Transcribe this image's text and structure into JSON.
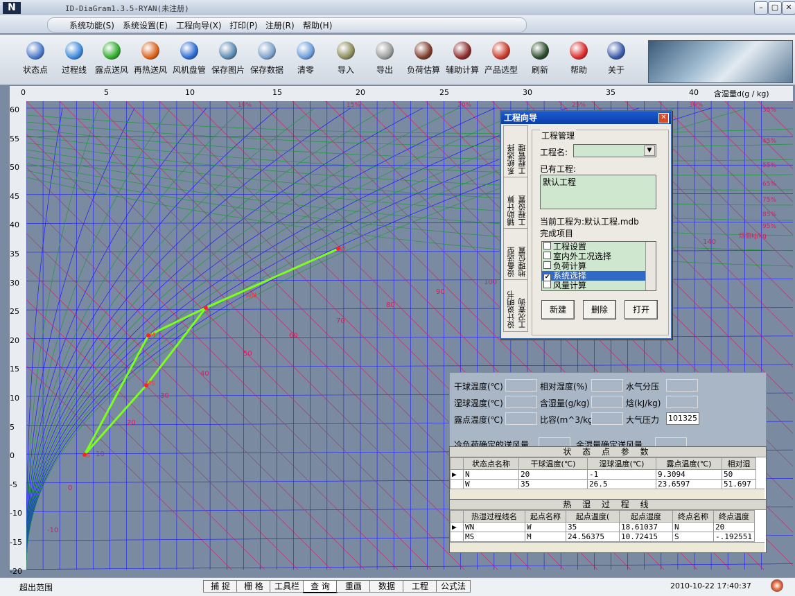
{
  "window": {
    "title": "ID-DiaGram1.3.5-RYAN(未注册)",
    "app_icon": "N"
  },
  "menu": [
    "系统功能(S)",
    "系统设置(E)",
    "工程向导(X)",
    "打印(P)",
    "注册(R)",
    "帮助(H)"
  ],
  "toolbar": [
    {
      "label": "状态点",
      "icon": "state-point-icon",
      "color": "#4a78c8"
    },
    {
      "label": "过程线",
      "icon": "process-line-icon",
      "color": "#3b88d8"
    },
    {
      "label": "露点送风",
      "icon": "green-ball-icon",
      "color": "#2faa2a"
    },
    {
      "label": "再热送风",
      "icon": "orange-ball-icon",
      "color": "#d8621c"
    },
    {
      "label": "风机盘管",
      "icon": "blue-ball-icon",
      "color": "#2a6ad0"
    },
    {
      "label": "保存图片",
      "icon": "save-image-icon",
      "color": "#5a88b0"
    },
    {
      "label": "保存数据",
      "icon": "save-data-icon",
      "color": "#7aa0c8"
    },
    {
      "label": "清零",
      "icon": "clear-icon",
      "color": "#6a9ad8"
    },
    {
      "label": "导入",
      "icon": "import-icon",
      "color": "#8a8a5a"
    },
    {
      "label": "导出",
      "icon": "export-icon",
      "color": "#999999"
    },
    {
      "label": "负荷估算",
      "icon": "load-estimate-icon",
      "color": "#7a3a2a"
    },
    {
      "label": "辅助计算",
      "icon": "aux-calc-icon",
      "color": "#8a2a2a"
    },
    {
      "label": "产品选型",
      "icon": "product-select-icon",
      "color": "#c83a2a"
    },
    {
      "label": "刷新",
      "icon": "refresh-icon",
      "color": "#2a4a2a"
    },
    {
      "label": "帮助",
      "icon": "help-icon",
      "color": "#d82a2a"
    },
    {
      "label": "关于",
      "icon": "about-icon",
      "color": "#3a5aa8"
    }
  ],
  "axis_top": {
    "ticks": [
      "0",
      "5",
      "10",
      "15",
      "20",
      "25",
      "30",
      "35",
      "40"
    ],
    "label": "含湿量d(g / kg)"
  },
  "axis_left": [
    "60",
    "55",
    "50",
    "45",
    "40",
    "35",
    "30",
    "25",
    "20",
    "15",
    "10",
    "5",
    "0",
    "-5",
    "-10",
    "-15",
    "-20"
  ],
  "chart": {
    "rh_labels": [
      "10%",
      "15%",
      "20%",
      "25%",
      "30%",
      "35%",
      "45%",
      "55%",
      "65%",
      "75%",
      "85%",
      "95%"
    ],
    "enthalpy_labels": [
      "-10",
      "0",
      "10",
      "20",
      "30",
      "40",
      "50",
      "60",
      "70",
      "80",
      "90",
      "100",
      "140"
    ],
    "enthalpy_unit": "焓值kJ/kg",
    "point_labels": [
      "W",
      "N",
      "M",
      "S",
      "WN",
      "MS"
    ],
    "colors": {
      "rh": "#1d9a3c",
      "temp": "#1a1aff",
      "enthalpy": "#cc2266",
      "process": "#7cff1c",
      "bg": "#7a8aa0"
    }
  },
  "dialog": {
    "title": "工程向导",
    "tabs": [
      "工程管理",
      "系统选择",
      "工程设置",
      "辅助计算",
      "地理位置",
      "设备选型",
      "工况查询",
      "设计说明书"
    ],
    "tab_icon_texts": [
      "<1",
      "<2",
      "<3",
      "<4"
    ],
    "group_label": "工程管理",
    "project_name_label": "工程名:",
    "existing_label": "已有工程:",
    "existing_item": "默认工程",
    "current_label": "当前工程为:默认工程.mdb",
    "complete_label": "完成项目",
    "checklist": [
      {
        "label": "工程设置",
        "checked": false
      },
      {
        "label": "室内外工况选择",
        "checked": false
      },
      {
        "label": "负荷计算",
        "checked": false
      },
      {
        "label": "系统选择",
        "checked": true
      },
      {
        "label": "风量计算",
        "checked": false
      }
    ],
    "buttons": [
      "新建",
      "删除",
      "打开"
    ]
  },
  "props": {
    "labels": [
      "干球温度(℃)",
      "相对湿度(%)",
      "水气分压",
      "湿球温度(℃)",
      "含湿量(g/kg)",
      "焓(kJ/kg)",
      "露点温度(℃)",
      "比容(m^3/kg)",
      "大气压力",
      "冷负荷确定的送风量",
      "余湿量确定送风量"
    ],
    "pressure": "101325"
  },
  "state_table": {
    "title": "状 态 点 参 数",
    "headers": [
      "状态点名称",
      "干球温度(℃)",
      "湿球温度(℃)",
      "露点温度(℃)",
      "相对湿"
    ],
    "rows": [
      [
        "N",
        "20",
        "-1",
        "9.3094",
        "50"
      ],
      [
        "W",
        "35",
        "26.5",
        "23.6597",
        "51.697"
      ]
    ]
  },
  "process_table": {
    "title": "热 湿 过 程 线",
    "headers": [
      "热湿过程线名",
      "起点名称",
      "起点温度(",
      "起点湿度",
      "终点名称",
      "终点温度"
    ],
    "rows": [
      [
        "WN",
        "W",
        "35",
        "18.61037",
        "N",
        "20"
      ],
      [
        "MS",
        "M",
        "24.56375",
        "10.72415",
        "S",
        "-.192551"
      ]
    ]
  },
  "status": {
    "left": "超出范围",
    "tabs": [
      "捕 捉",
      "栅 格",
      "工具栏",
      "查 询",
      "重画",
      "数据",
      "工程",
      "公式法"
    ],
    "active_tab": "查 询",
    "datetime": "2010-10-22 17:40:37"
  }
}
